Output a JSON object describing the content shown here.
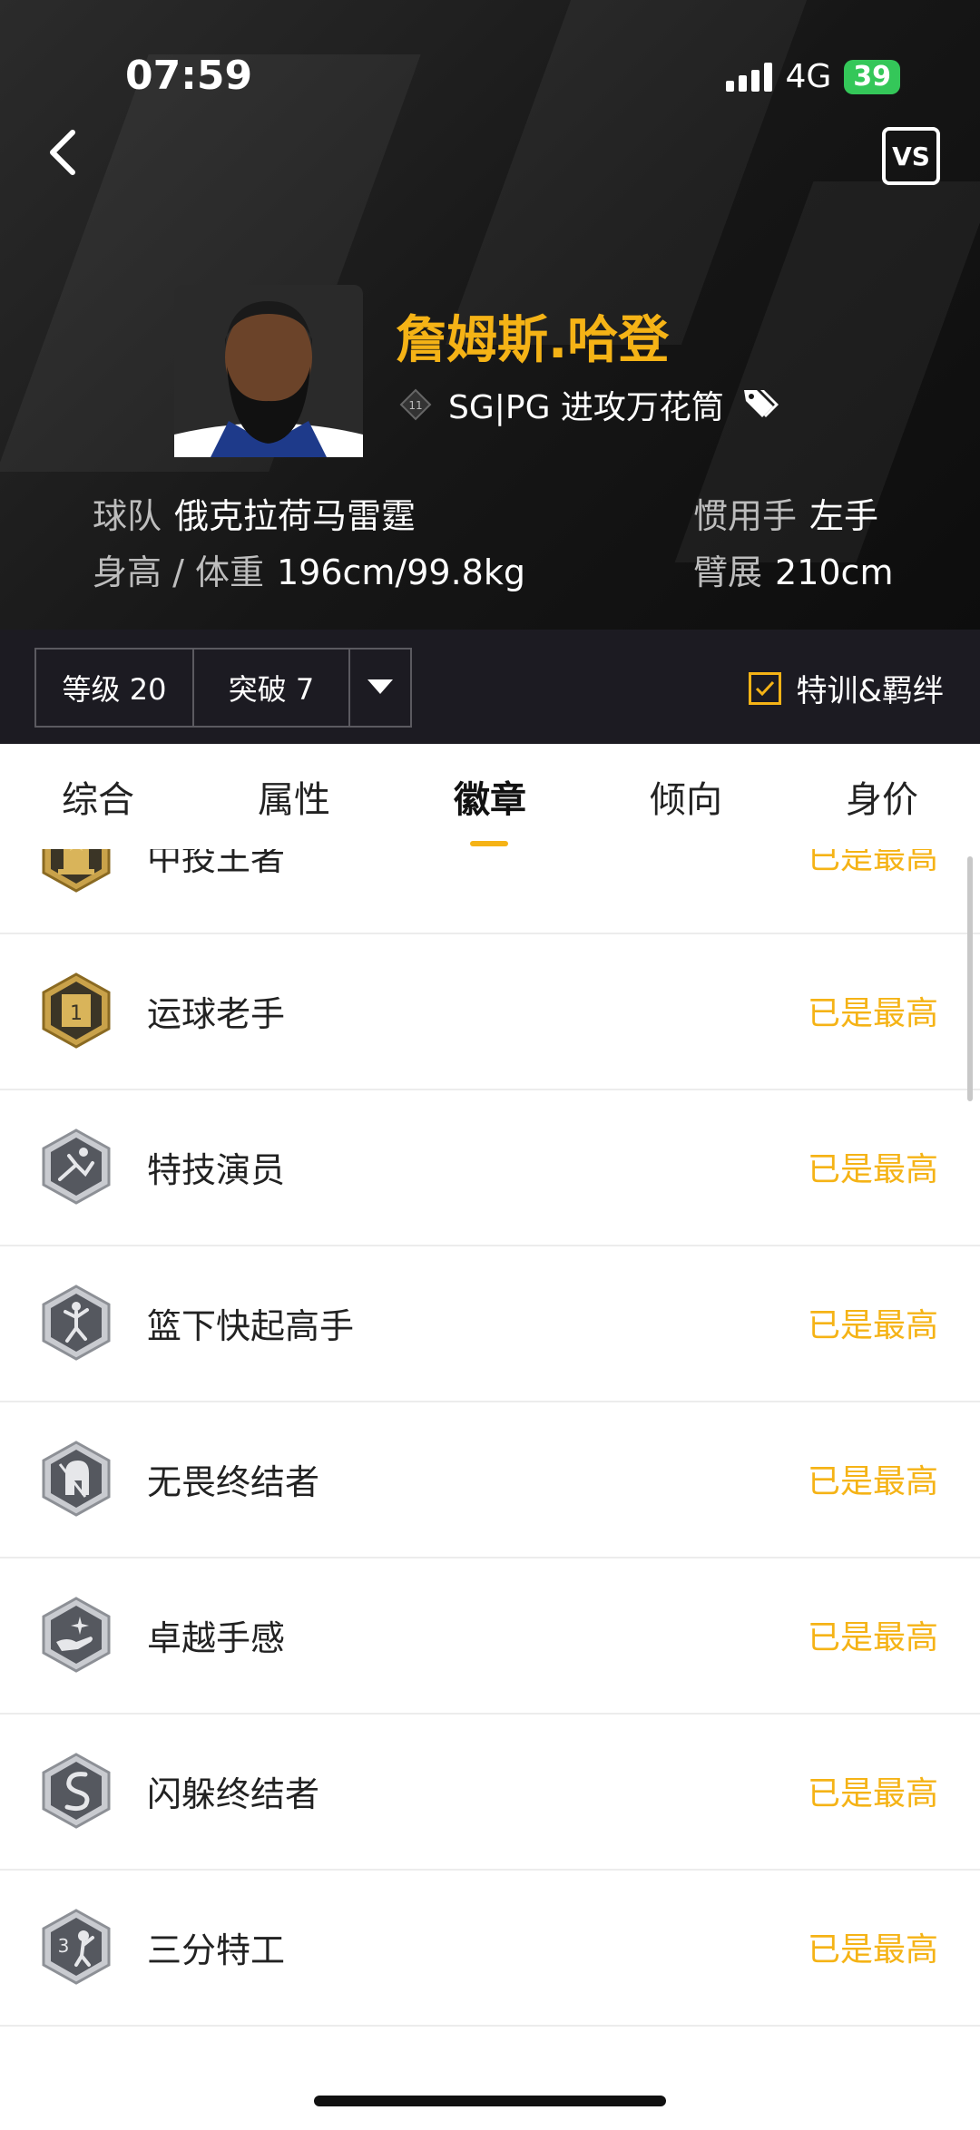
{
  "status_bar": {
    "time": "07:59",
    "network": "4G",
    "battery": "39"
  },
  "header": {
    "vs_label": "VS",
    "player_name": "詹姆斯.哈登",
    "rank_number": "11",
    "position_role": "SG|PG 进攻万花筒",
    "team_label": "球队",
    "team_value": "俄克拉荷马雷霆",
    "height_weight_label": "身高 / 体重",
    "height_weight_value": "196cm/99.8kg",
    "hand_label": "惯用手",
    "hand_value": "左手",
    "wingspan_label": "臂展",
    "wingspan_value": "210cm"
  },
  "controls": {
    "level": "等级 20",
    "breakthrough": "突破 7",
    "training_label": "特训&羁绊",
    "training_checked": true
  },
  "tabs": [
    {
      "label": "综合"
    },
    {
      "label": "属性"
    },
    {
      "label": "徽章",
      "active": true
    },
    {
      "label": "倾向"
    },
    {
      "label": "身价"
    }
  ],
  "badges": [
    {
      "name": "中投王者",
      "status": "已是最高",
      "tier": "gold",
      "icon": "magic-hat-icon"
    },
    {
      "name": "运球老手",
      "status": "已是最高",
      "tier": "gold",
      "icon": "calendar-one-icon"
    },
    {
      "name": "特技演员",
      "status": "已是最高",
      "tier": "silver",
      "icon": "acrobat-icon"
    },
    {
      "name": "篮下快起高手",
      "status": "已是最高",
      "tier": "silver",
      "icon": "jumper-icon"
    },
    {
      "name": "无畏终结者",
      "status": "已是最高",
      "tier": "silver",
      "icon": "spartan-helmet-icon"
    },
    {
      "name": "卓越手感",
      "status": "已是最高",
      "tier": "silver",
      "icon": "sparkle-hand-icon"
    },
    {
      "name": "闪躲终结者",
      "status": "已是最高",
      "tier": "silver",
      "icon": "snake-icon"
    },
    {
      "name": "三分特工",
      "status": "已是最高",
      "tier": "silver",
      "icon": "three-point-agent-icon"
    }
  ],
  "colors": {
    "accent": "#f5b316",
    "header_bg": "#161616",
    "control_bg": "#1c1b22",
    "battery": "#34c759"
  }
}
